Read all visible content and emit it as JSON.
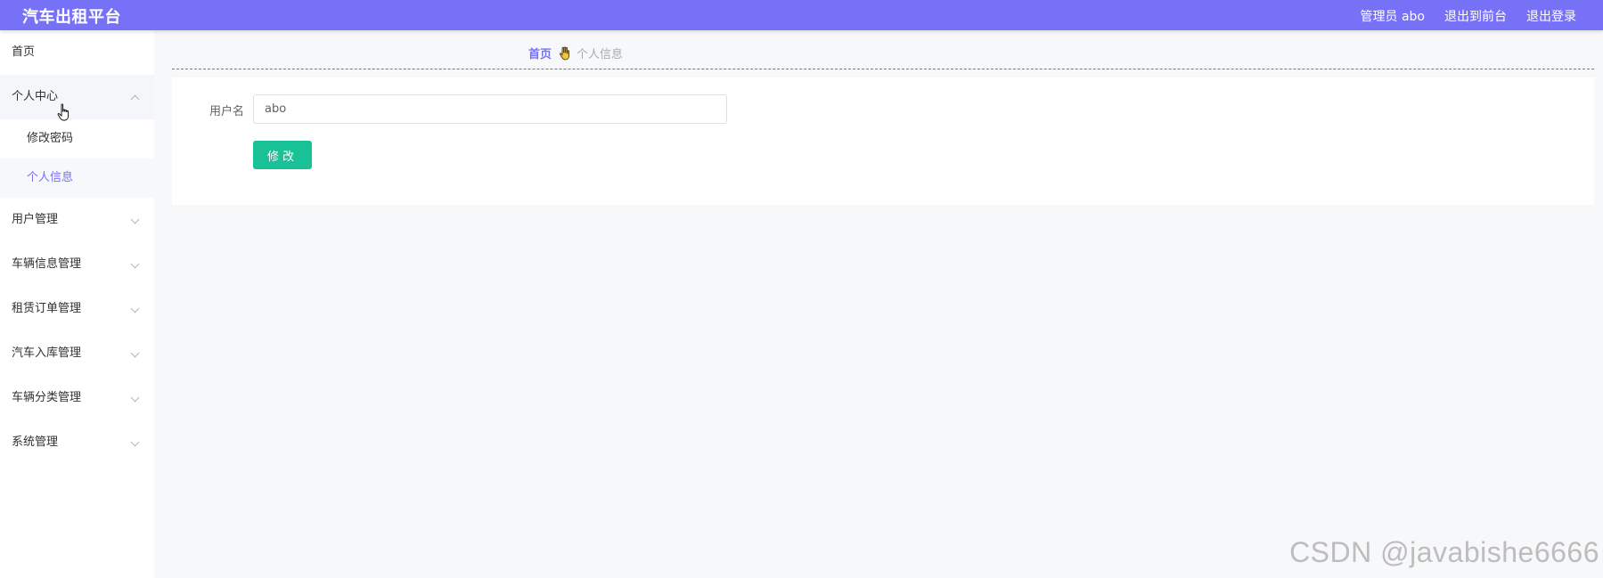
{
  "header": {
    "brand": "汽车出租平台",
    "admin_label": "管理员 abo",
    "to_front_label": "退出到前台",
    "logout_label": "退出登录",
    "bg_color": "#7771f7"
  },
  "sidebar": {
    "home": "首页",
    "groups": [
      {
        "label": "个人中心",
        "expanded": true,
        "children": [
          "修改密码",
          "个人信息"
        ],
        "active_child": "个人信息"
      },
      {
        "label": "用户管理",
        "expanded": false
      },
      {
        "label": "车辆信息管理",
        "expanded": false
      },
      {
        "label": "租赁订单管理",
        "expanded": false
      },
      {
        "label": "汽车入库管理",
        "expanded": false
      },
      {
        "label": "车辆分类管理",
        "expanded": false
      },
      {
        "label": "系统管理",
        "expanded": false
      }
    ]
  },
  "breadcrumb": {
    "home": "首页",
    "separator_icon": "hand-icon",
    "current": "个人信息"
  },
  "form": {
    "username_label": "用户名",
    "username_value": "abo",
    "submit_label": "修改"
  },
  "watermark": "CSDN @javabishe6666",
  "colors": {
    "accent": "#7771f7",
    "button": "#19c196"
  }
}
